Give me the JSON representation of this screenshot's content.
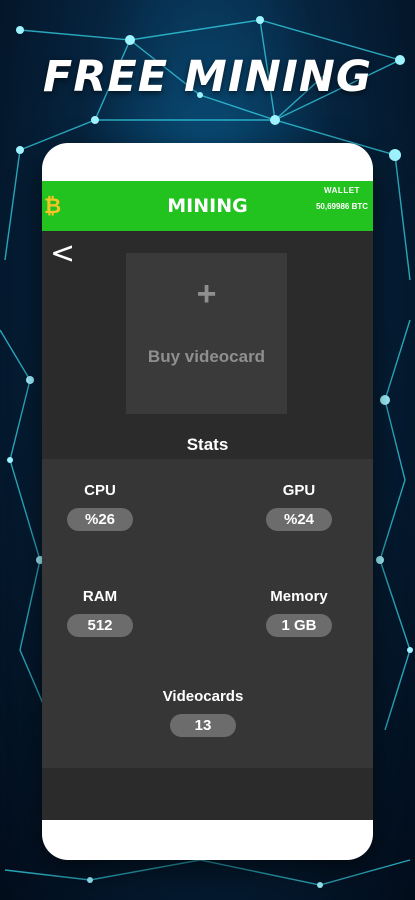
{
  "promo": {
    "title": "FREE MINING"
  },
  "app": {
    "title": "MINING",
    "wallet": {
      "label": "WALLET",
      "value": "50,69986 BTC"
    },
    "back_glyph": "<",
    "buy_card": {
      "icon": "plus-icon",
      "plus_glyph": "+",
      "label": "Buy videocard"
    },
    "stats": {
      "title": "Stats",
      "items": [
        {
          "label": "CPU",
          "value": "%26"
        },
        {
          "label": "GPU",
          "value": "%24"
        },
        {
          "label": "RAM",
          "value": "512"
        },
        {
          "label": "Memory",
          "value": "1 GB"
        },
        {
          "label": "Videocards",
          "value": "13"
        }
      ]
    },
    "colors": {
      "accent_green": "#22c21f",
      "bitcoin_gold": "#f7c325",
      "screen_bg": "#2b2b2b",
      "pill_bg": "#6c6c6c"
    }
  }
}
